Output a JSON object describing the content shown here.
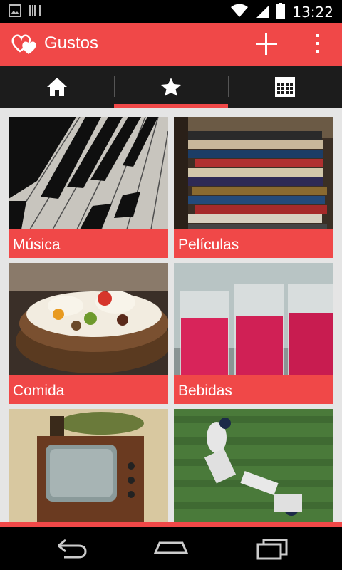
{
  "status": {
    "time": "13:22",
    "left_icons": [
      "image-icon",
      "barcode-icon"
    ],
    "right_icons": [
      "wifi-icon",
      "signal-icon",
      "battery-icon"
    ]
  },
  "actionbar": {
    "title": "Gustos",
    "logo_icon": "hearts-logo-icon",
    "add_icon": "plus-icon",
    "menu_icon": "overflow-menu-icon"
  },
  "tabs": [
    {
      "icon": "home-icon",
      "selected": false
    },
    {
      "icon": "star-icon",
      "selected": true
    },
    {
      "icon": "calendar-icon",
      "selected": false
    }
  ],
  "categories": [
    {
      "label": "Música",
      "image": "piano-keys"
    },
    {
      "label": "Películas",
      "image": "dvd-stack"
    },
    {
      "label": "Comida",
      "image": "cake"
    },
    {
      "label": "Bebidas",
      "image": "pink-drinks"
    },
    {
      "label": "",
      "image": "retro-tv"
    },
    {
      "label": "",
      "image": "baseball-players"
    }
  ],
  "navbar": {
    "back_icon": "back-icon",
    "home_icon": "home-nav-icon",
    "recents_icon": "recents-icon"
  },
  "colors": {
    "accent": "#f04848",
    "tabbar": "#1c1c1c",
    "grid_bg": "#e5e5e5"
  }
}
